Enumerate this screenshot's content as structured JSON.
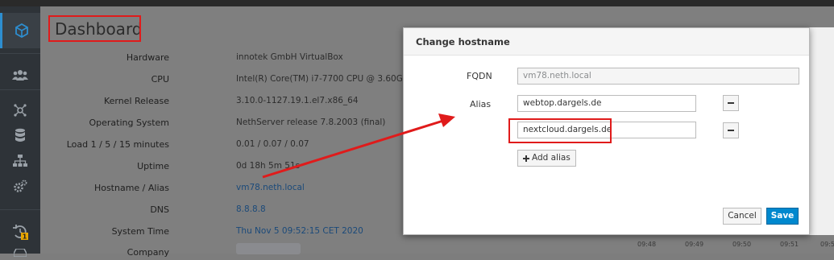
{
  "page": {
    "title": "Dashboard"
  },
  "sidebar": {
    "items": [
      {
        "name": "cube-icon",
        "active": true
      },
      {
        "name": "users-icon"
      },
      {
        "name": "network-icon"
      },
      {
        "name": "database-icon"
      },
      {
        "name": "sitemap-icon"
      },
      {
        "name": "gears-icon"
      },
      {
        "name": "history-icon",
        "badge": "1"
      }
    ]
  },
  "system_info": [
    {
      "label": "Hardware",
      "value": "innotek GmbH VirtualBox"
    },
    {
      "label": "CPU",
      "value": "Intel(R) Core(TM) i7-7700 CPU @ 3.60GHz x 1"
    },
    {
      "label": "Kernel Release",
      "value": "3.10.0-1127.19.1.el7.x86_64"
    },
    {
      "label": "Operating System",
      "value": "NethServer release 7.8.2003 (final)"
    },
    {
      "label": "Load 1 / 5 / 15 minutes",
      "value": "0.01 / 0.07 / 0.07"
    },
    {
      "label": "Uptime",
      "value": "0d 18h 5m 51s"
    },
    {
      "label": "Hostname / Alias",
      "value": "vm78.neth.local"
    },
    {
      "label": "DNS",
      "value": "8.8.8.8"
    },
    {
      "label": "System Time",
      "value": "Thu Nov 5 09:52:15 CET 2020"
    },
    {
      "label": "Company",
      "value": ""
    }
  ],
  "chart_ticks": [
    "09:48",
    "09:49",
    "09:50",
    "09:51",
    "09:5"
  ],
  "modal": {
    "title": "Change hostname",
    "fqdn_label": "FQDN",
    "fqdn_value": "vm78.neth.local",
    "alias_label": "Alias",
    "aliases": [
      "webtop.dargels.de",
      "nextcloud.dargels.de"
    ],
    "add_alias_label": "Add alias",
    "cancel_label": "Cancel",
    "save_label": "Save"
  },
  "colors": {
    "accent": "#0088ce",
    "highlight": "#e01b1b",
    "sidebar": "#2e3338"
  }
}
